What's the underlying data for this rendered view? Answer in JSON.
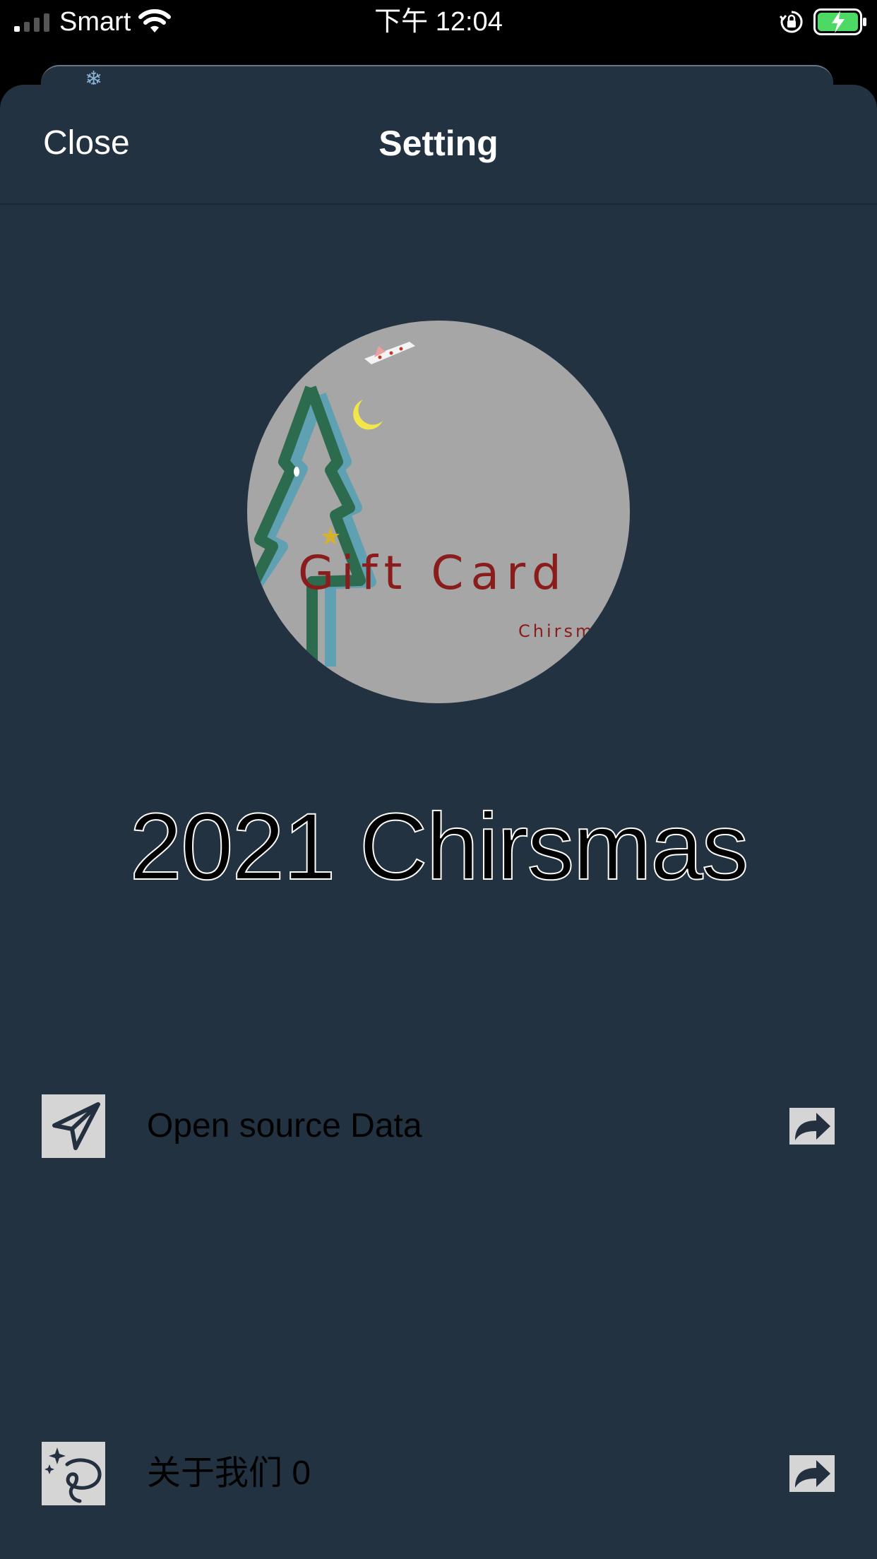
{
  "status_bar": {
    "carrier": "Smart",
    "time": "下午 12:04",
    "signal_icon": "cellular-signal-icon",
    "wifi_icon": "wifi-icon",
    "lock_icon": "orientation-lock-icon",
    "battery_icon": "battery-charging-icon",
    "battery_color": "#4cd964"
  },
  "nav": {
    "close_label": "Close",
    "title": "Setting"
  },
  "card": {
    "image_text": "Gift Card",
    "image_subtext": "Chirsm",
    "title": "2021 Chirsmas",
    "image_bg_color": "#a6a6a6"
  },
  "rows": [
    {
      "icon": "send-icon",
      "label": "Open source Data",
      "action_icon": "share-arrow-icon"
    },
    {
      "icon": "sparkle-lasso-icon",
      "label": "关于我们 0",
      "action_icon": "share-arrow-icon"
    }
  ],
  "colors": {
    "sheet_bg": "#223241",
    "status_bg": "#000000",
    "icon_tile": "#d5d5d5",
    "icon_stroke": "#24303f"
  }
}
